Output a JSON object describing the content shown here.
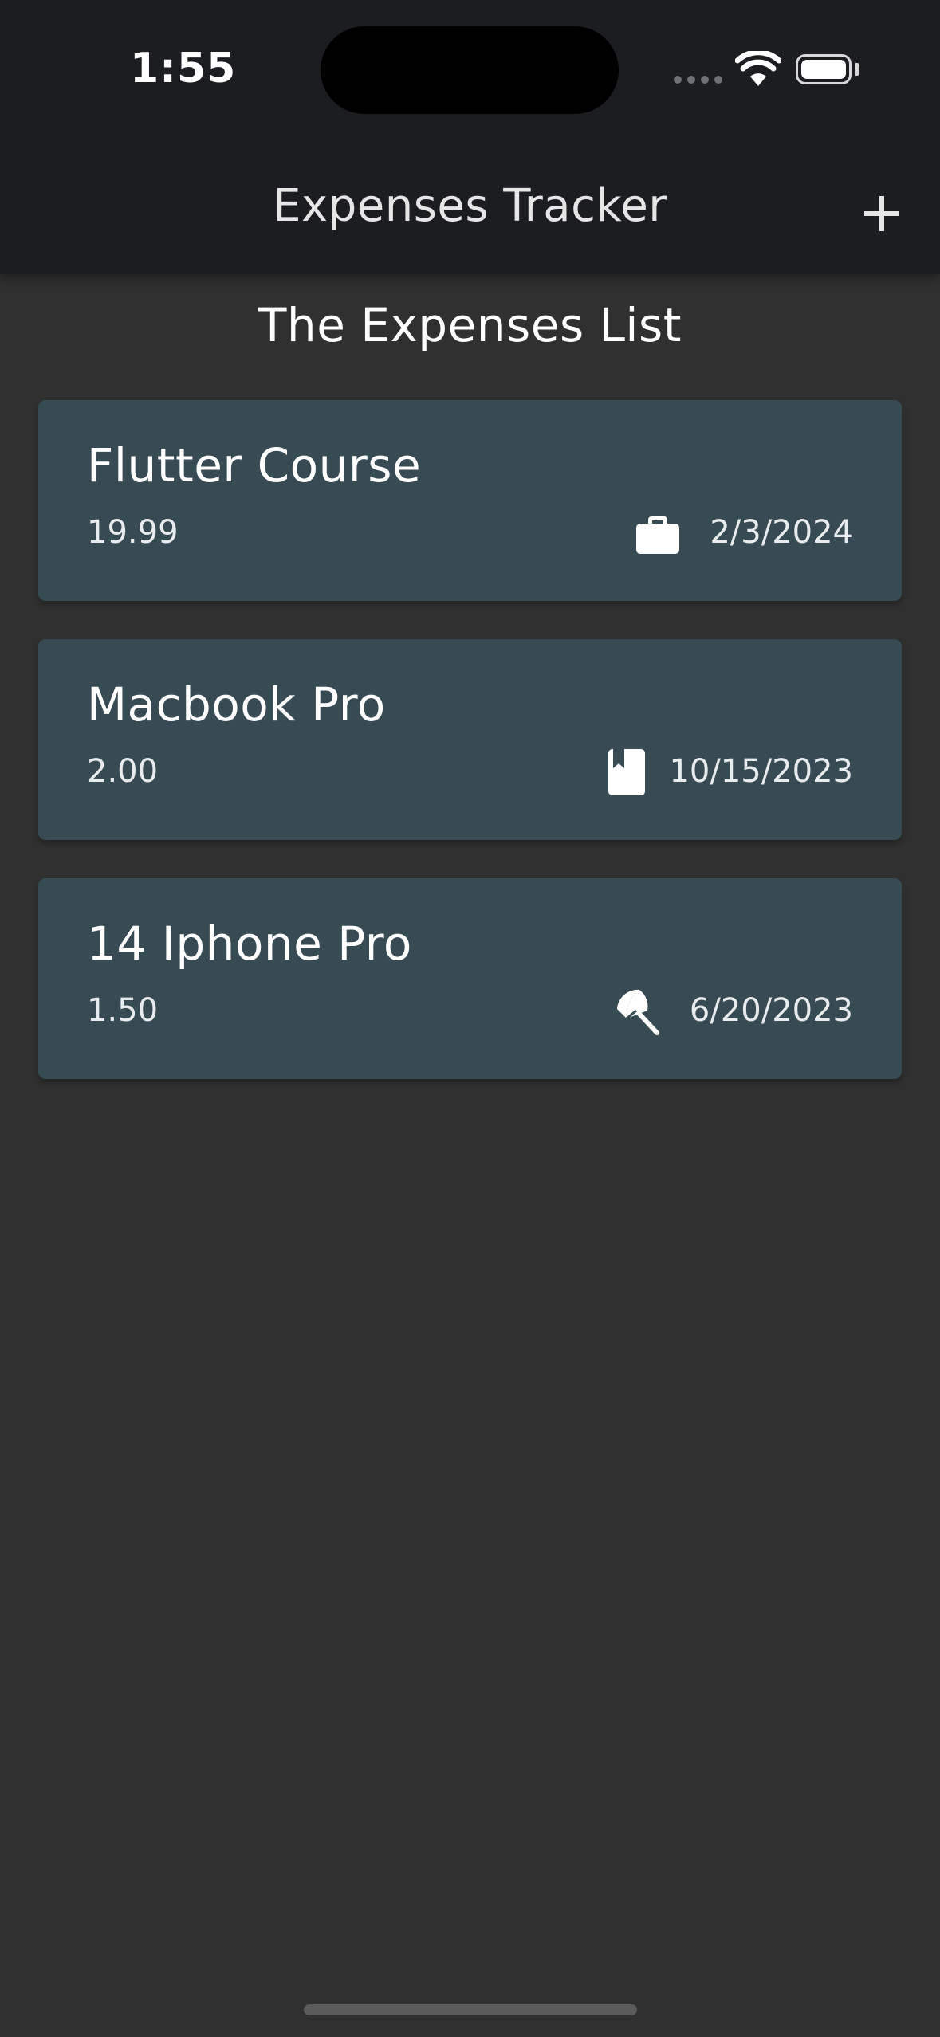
{
  "status_bar": {
    "time": "1:55"
  },
  "app_bar": {
    "title": "Expenses Tracker",
    "add_icon": "plus-icon"
  },
  "list": {
    "heading": "The Expenses List",
    "expenses": [
      {
        "title": "Flutter Course",
        "amount": "19.99",
        "date": "2/3/2024",
        "category_icon": "briefcase-icon"
      },
      {
        "title": "Macbook Pro",
        "amount": "2.00",
        "date": "10/15/2023",
        "category_icon": "book-icon"
      },
      {
        "title": "14 Iphone Pro",
        "amount": "1.50",
        "date": "6/20/2023",
        "category_icon": "beach-umbrella-icon"
      }
    ]
  },
  "colors": {
    "background": "#303030",
    "app_bar": "#1b1d21",
    "card": "#374b55",
    "text": "#ffffff"
  }
}
